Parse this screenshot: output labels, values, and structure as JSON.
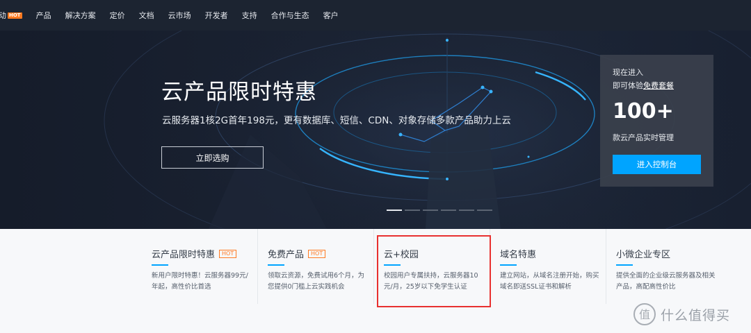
{
  "nav": {
    "items": [
      {
        "label": "动",
        "hot": "HOT"
      },
      {
        "label": "产品"
      },
      {
        "label": "解决方案"
      },
      {
        "label": "定价"
      },
      {
        "label": "文档"
      },
      {
        "label": "云市场"
      },
      {
        "label": "开发者"
      },
      {
        "label": "支持"
      },
      {
        "label": "合作与生态"
      },
      {
        "label": "客户"
      }
    ]
  },
  "hero": {
    "title": "云产品限时特惠",
    "subtitle": "云服务器1核2G首年198元，更有数据库、短信、CDN、对象存储多款产品助力上云",
    "button_label": "立即选购",
    "carousel_slide_count": 6,
    "carousel_active_index": 0
  },
  "side_card": {
    "line1": "现在进入",
    "line2_prefix": "即可体验",
    "line2_link": "免费套餐",
    "number": "100+",
    "desc": "款云产品实时管理",
    "button_label": "进入控制台"
  },
  "features": [
    {
      "title": "云产品限时特惠",
      "hot": "HOT",
      "desc": "新用户限时特惠！云服务器99元/年起，高性价比首选"
    },
    {
      "title": "免费产品",
      "hot": "HOT",
      "desc": "领取云资源，免费试用6个月，为您提供0门槛上云实践机会"
    },
    {
      "title": "云+校园",
      "hot": "",
      "desc": "校园用户专属扶持，云服务器10元/月，25岁以下免学生认证"
    },
    {
      "title": "域名特惠",
      "hot": "",
      "desc": "建立网站，从域名注册开始，购买域名即送SSL证书和解析"
    },
    {
      "title": "小微企业专区",
      "hot": "",
      "desc": "提供全面的企业级云服务器及相关产品，高配高性价比"
    }
  ],
  "watermark": {
    "text": "什么值得买",
    "icon": "zhi-logo-icon"
  },
  "colors": {
    "nav_bg": "#1c2431",
    "hot_badge": "#ff7a21",
    "accent": "#00a4ff",
    "highlight": "#e8302f",
    "feature_bg": "#f7f8fa"
  }
}
